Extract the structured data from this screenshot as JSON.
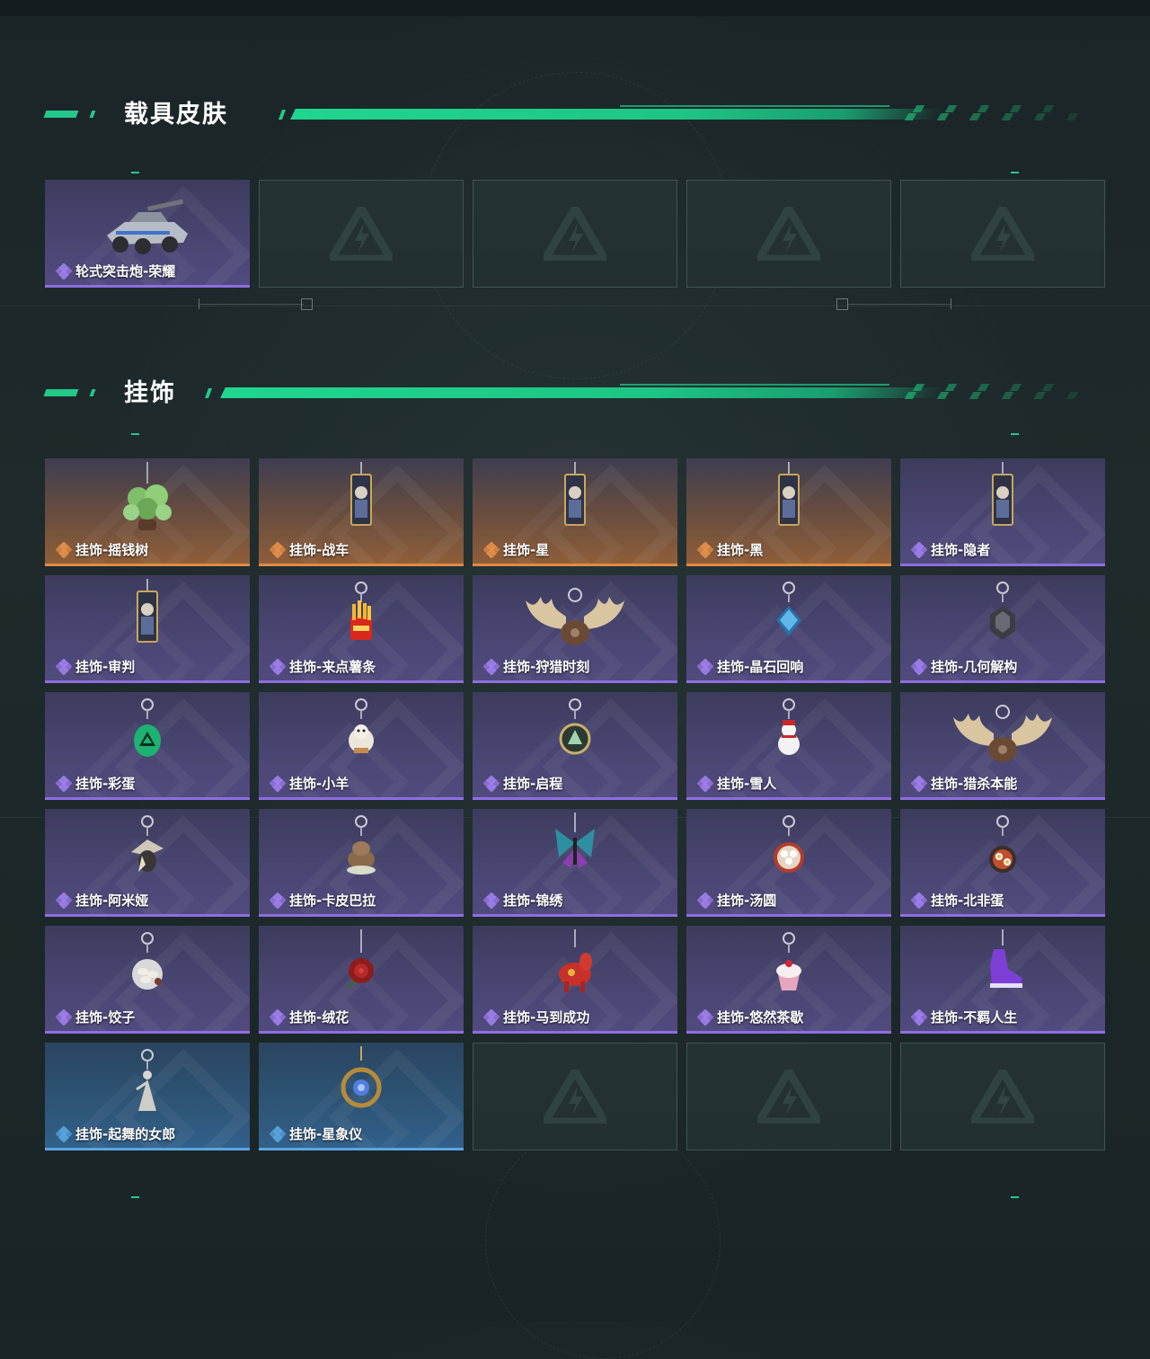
{
  "sections": [
    {
      "title": "载具皮肤",
      "items": [
        {
          "label": "轮式突击炮-荣耀",
          "rarity": "purple",
          "art": "vehicle-icon"
        },
        {
          "empty": true
        },
        {
          "empty": true
        },
        {
          "empty": true
        },
        {
          "empty": true
        }
      ]
    },
    {
      "title": "挂饰",
      "items": [
        {
          "label": "挂饰-摇钱树",
          "rarity": "orange",
          "art": "money-tree-icon"
        },
        {
          "label": "挂饰-战车",
          "rarity": "orange",
          "art": "card-charm-icon"
        },
        {
          "label": "挂饰-星",
          "rarity": "orange",
          "art": "card-charm-icon"
        },
        {
          "label": "挂饰-黑",
          "rarity": "orange",
          "art": "card-charm-icon"
        },
        {
          "label": "挂饰-隐者",
          "rarity": "purple",
          "art": "card-charm-icon"
        },
        {
          "label": "挂饰-审判",
          "rarity": "purple",
          "art": "card-charm-icon"
        },
        {
          "label": "挂饰-来点薯条",
          "rarity": "purple",
          "art": "fries-icon"
        },
        {
          "label": "挂饰-狩猎时刻",
          "rarity": "purple",
          "art": "antlers-icon"
        },
        {
          "label": "挂饰-晶石回响",
          "rarity": "purple",
          "art": "crystal-icon"
        },
        {
          "label": "挂饰-几何解构",
          "rarity": "purple",
          "art": "geometric-icon"
        },
        {
          "label": "挂饰-彩蛋",
          "rarity": "purple",
          "art": "egg-icon"
        },
        {
          "label": "挂饰-小羊",
          "rarity": "purple",
          "art": "sheep-icon"
        },
        {
          "label": "挂饰-启程",
          "rarity": "purple",
          "art": "medal-icon"
        },
        {
          "label": "挂饰-雪人",
          "rarity": "purple",
          "art": "snowman-icon"
        },
        {
          "label": "挂饰-猎杀本能",
          "rarity": "purple",
          "art": "antlers-icon"
        },
        {
          "label": "挂饰-阿米娅",
          "rarity": "purple",
          "art": "rabbit-icon"
        },
        {
          "label": "挂饰-卡皮巴拉",
          "rarity": "purple",
          "art": "capybara-icon"
        },
        {
          "label": "挂饰-锦绣",
          "rarity": "purple",
          "art": "butterfly-icon"
        },
        {
          "label": "挂饰-汤圆",
          "rarity": "purple",
          "art": "bowl-icon"
        },
        {
          "label": "挂饰-北非蛋",
          "rarity": "purple",
          "art": "pan-icon"
        },
        {
          "label": "挂饰-饺子",
          "rarity": "purple",
          "art": "plate-icon"
        },
        {
          "label": "挂饰-绒花",
          "rarity": "purple",
          "art": "rose-icon"
        },
        {
          "label": "挂饰-马到成功",
          "rarity": "purple",
          "art": "horse-icon"
        },
        {
          "label": "挂饰-悠然茶歇",
          "rarity": "purple",
          "art": "cupcake-icon"
        },
        {
          "label": "挂饰-不羁人生",
          "rarity": "purple",
          "art": "sneaker-icon"
        },
        {
          "label": "挂饰-起舞的女郎",
          "rarity": "blue",
          "art": "dancer-icon"
        },
        {
          "label": "挂饰-星象仪",
          "rarity": "blue",
          "art": "astrolabe-icon"
        },
        {
          "empty": true
        },
        {
          "empty": true
        },
        {
          "empty": true
        }
      ]
    }
  ],
  "colors": {
    "accent": "#23c98a",
    "purple": "#8e6ee0",
    "orange": "#e08a45",
    "blue": "#5ba6e2"
  }
}
